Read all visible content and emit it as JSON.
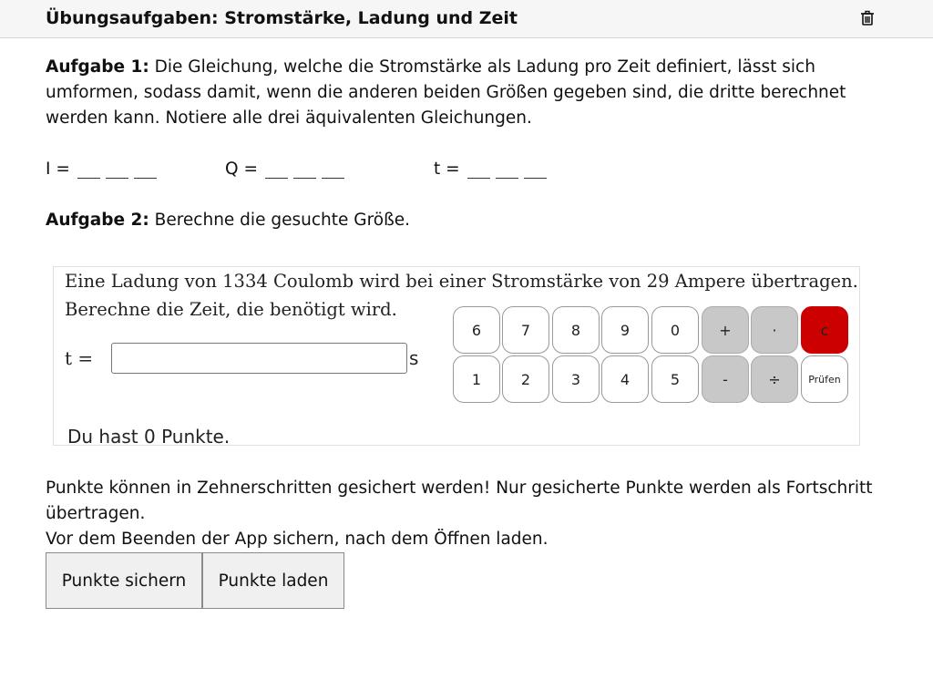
{
  "header": {
    "title": "Übungsaufgaben: Stromstärke, Ladung und Zeit"
  },
  "task1": {
    "label": "Aufgabe 1:",
    "line1": " Die Gleichung, welche die Stromstärke als Ladung pro Zeit definiert, lässt sich",
    "line2": "umformen, sodass damit, wenn die anderen beiden Größen gegeben sind, die dritte berechnet",
    "line3": "werden kann. Notiere alle drei äquivalenten Gleichungen.",
    "equations": [
      {
        "label": "I ="
      },
      {
        "label": "Q ="
      },
      {
        "label": "t ="
      }
    ]
  },
  "task2": {
    "label": "Aufgabe 2:",
    "text": " Berechne die gesuchte Größe."
  },
  "exercise": {
    "question_line1": "Eine Ladung von 1334 Coulomb wird bei einer Stromstärke von 29 Ampere übertragen.",
    "question_line2": "Berechne die Zeit, die benötigt wird.",
    "answer_label": "t =",
    "answer_value": "",
    "unit": "s",
    "score_text": "Du hast 0 Punkte.",
    "keypad": {
      "row1": [
        "6",
        "7",
        "8",
        "9",
        "0",
        "+",
        "·",
        "c"
      ],
      "row2": [
        "1",
        "2",
        "3",
        "4",
        "5",
        "-",
        "÷",
        "Prüfen"
      ]
    }
  },
  "footer": {
    "info_line1": "Punkte können in Zehnerschritten gesichert werden! Nur gesicherte Punkte werden als Fortschritt",
    "info_line2": "übertragen.",
    "info_line3": "Vor dem Beenden der App sichern, nach dem Öffnen laden.",
    "save_label": "Punkte sichern",
    "load_label": "Punkte laden"
  },
  "colors": {
    "operator_key": "#c8c8c8",
    "clear_key": "#cc0000"
  }
}
